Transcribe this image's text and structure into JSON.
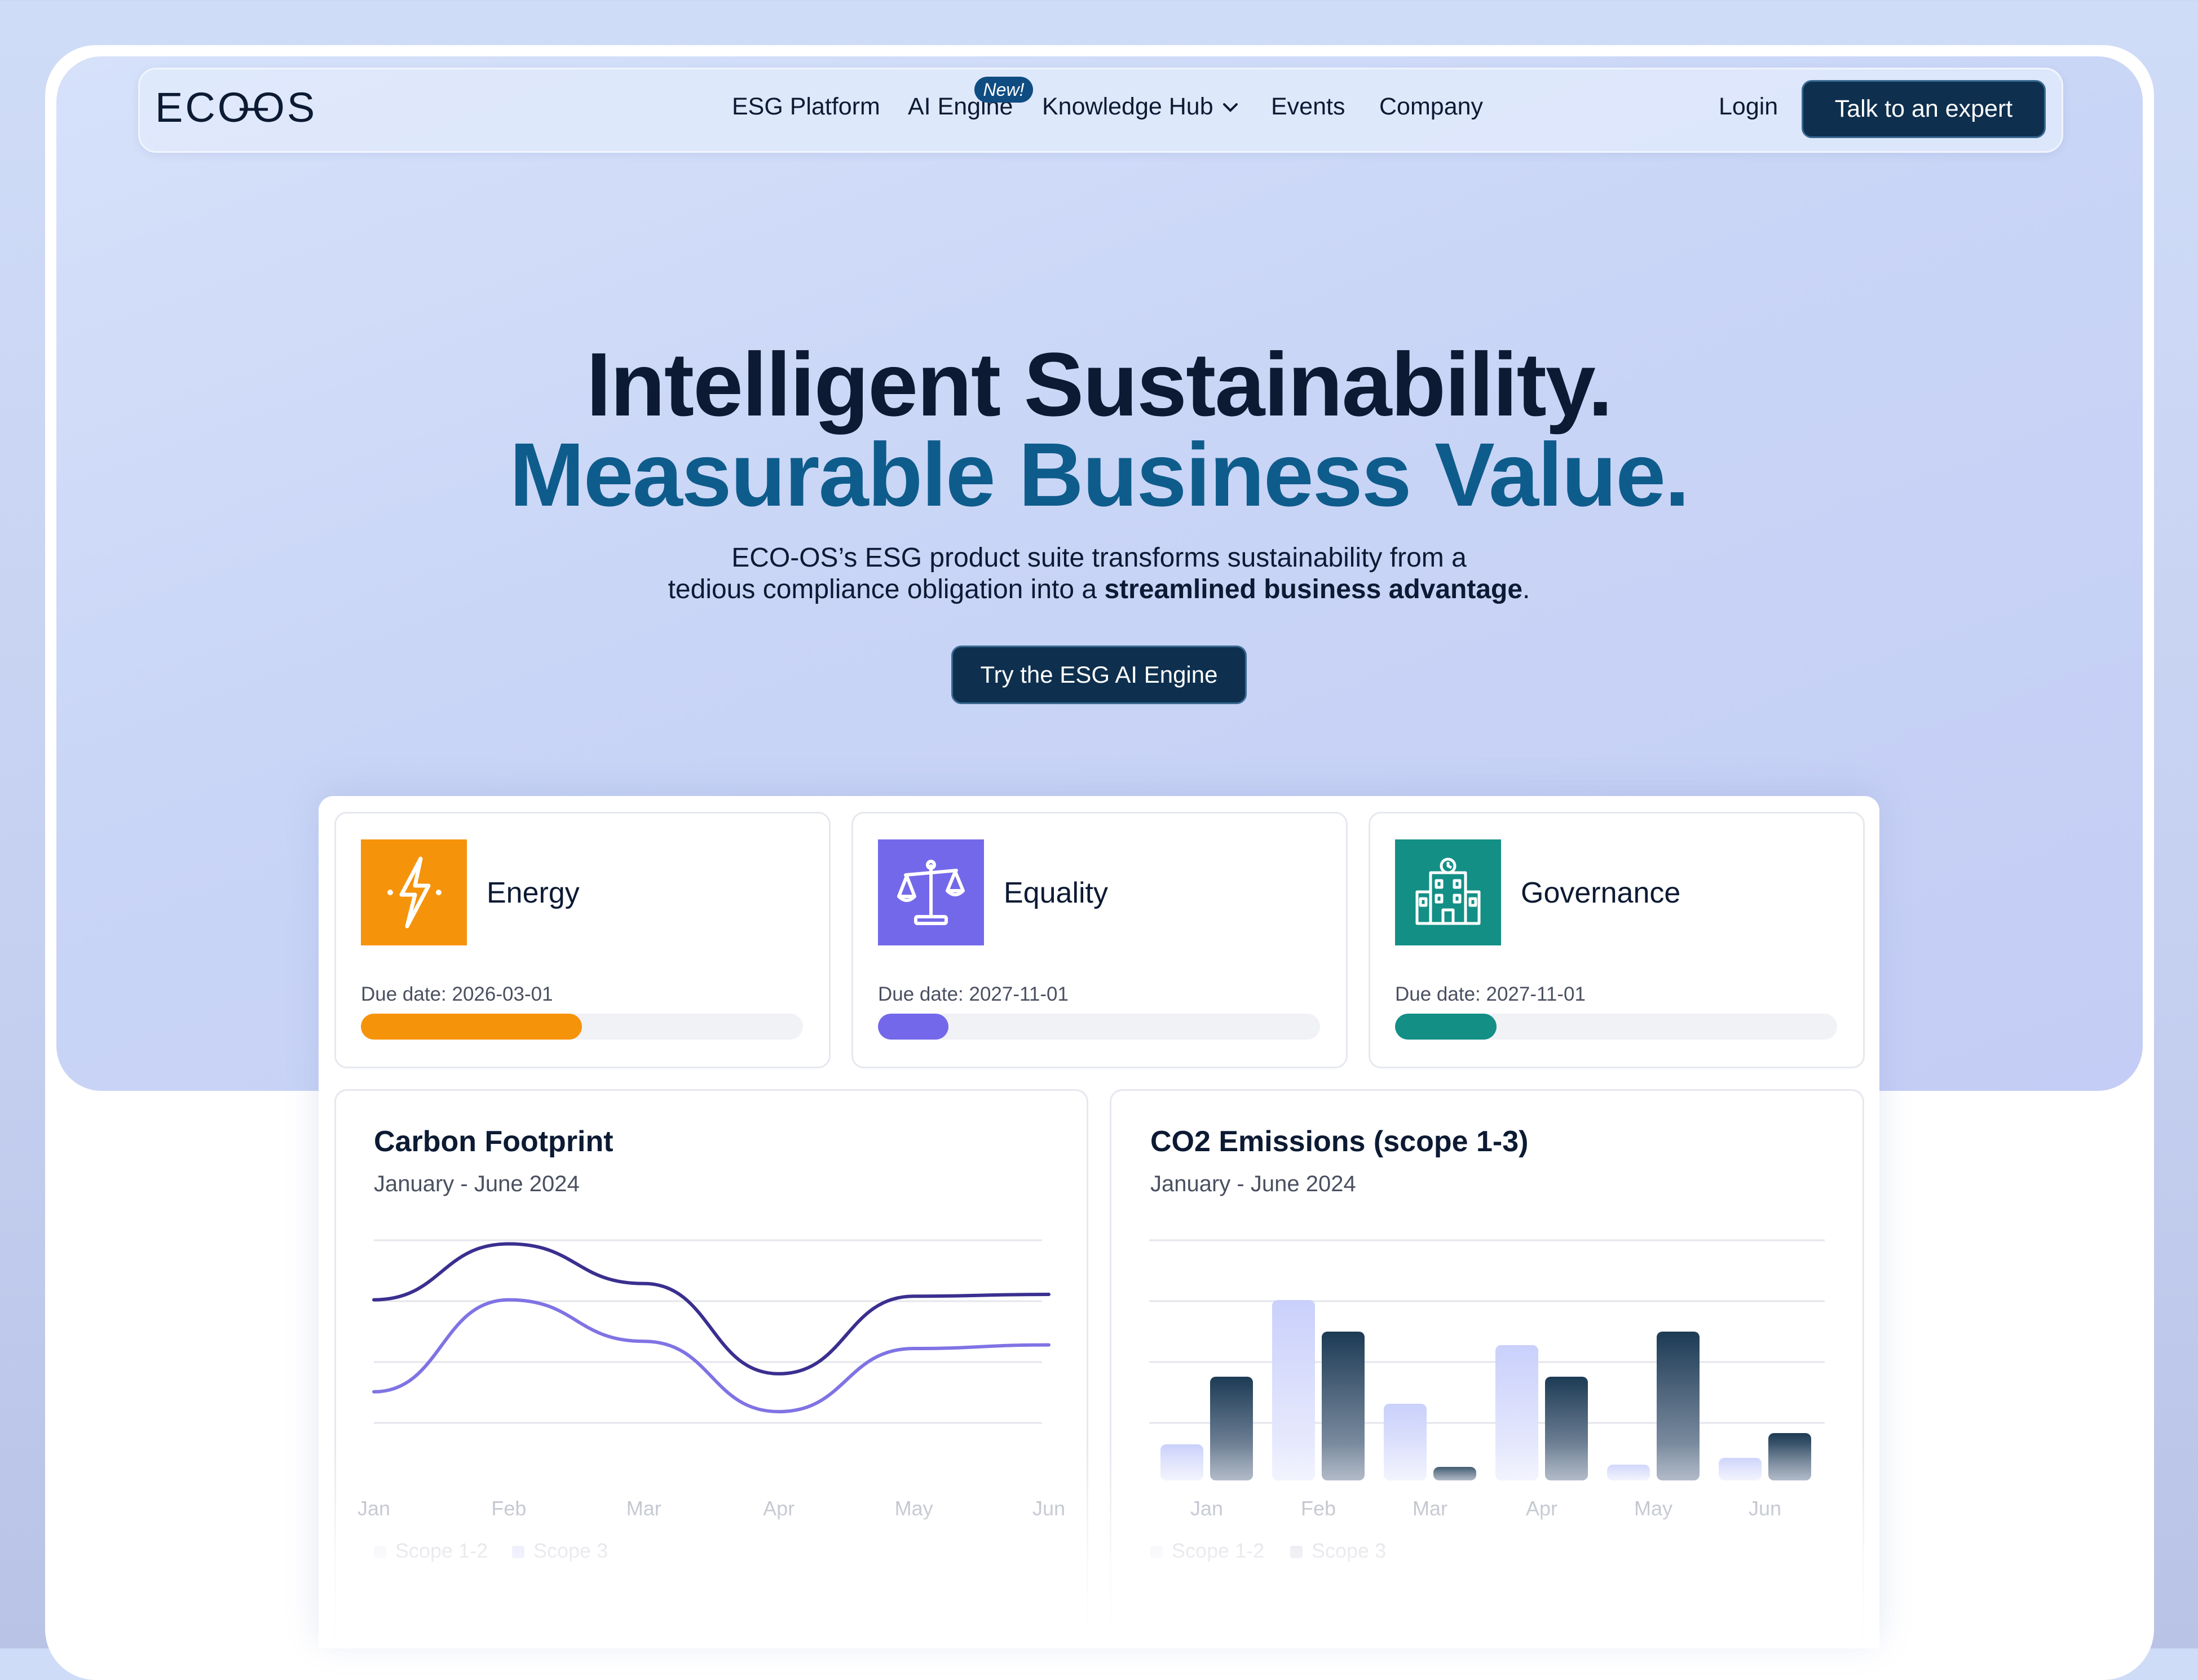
{
  "brand": {
    "logo_text": "ECOOS"
  },
  "nav": {
    "items": [
      {
        "label": "ESG Platform"
      },
      {
        "label": "AI Engine",
        "badge": "New!"
      },
      {
        "label": "Knowledge Hub"
      },
      {
        "label": "Events"
      },
      {
        "label": "Company"
      }
    ],
    "login_label": "Login",
    "cta_label": "Talk to an expert"
  },
  "hero": {
    "headline_1": "Intelligent Sustainability.",
    "headline_2": "Measurable Business Value.",
    "description_line_1": "ECO-OS’s ESG product suite transforms sustainability from a",
    "description_line_2_pre": "tedious compliance obligation into a ",
    "description_line_2_bold": "streamlined business advantage",
    "description_line_2_post": ".",
    "cta_label": "Try the ESG AI Engine"
  },
  "cards": [
    {
      "title": "Energy",
      "due": "Due date: 2026-03-01",
      "progress": 0.5,
      "color": "#f5930a",
      "icon": "lightning-icon"
    },
    {
      "title": "Equality",
      "due": "Due date: 2027-11-01",
      "progress": 0.16,
      "color": "#7468ea",
      "icon": "scales-icon"
    },
    {
      "title": "Governance",
      "due": "Due date: 2027-11-01",
      "progress": 0.23,
      "color": "#138f86",
      "icon": "building-icon"
    }
  ],
  "chart_data": [
    {
      "type": "line",
      "title": "Carbon Footprint",
      "subtitle": "January - June 2024",
      "categories": [
        "Jan",
        "Feb",
        "Mar",
        "Apr",
        "May",
        "Jun"
      ],
      "series": [
        {
          "name": "Scope 1-2",
          "values": [
            67,
            98,
            76,
            26,
            69,
            70
          ],
          "color": "#3a2f8f"
        },
        {
          "name": "Scope 3",
          "values": [
            16,
            67,
            44,
            5,
            40,
            42
          ],
          "color": "#7f73e4"
        }
      ],
      "ylim": [
        -100,
        100
      ],
      "legend": "bottom-left"
    },
    {
      "type": "bar",
      "title": "CO2 Emissions (scope 1-3)",
      "subtitle": "January - June 2024",
      "categories": [
        "Jan",
        "Feb",
        "Mar",
        "Apr",
        "May",
        "Jun"
      ],
      "series": [
        {
          "name": "Scope 1-2",
          "values": [
            16,
            80,
            34,
            60,
            7,
            10
          ]
        },
        {
          "name": "Scope 3",
          "values": [
            46,
            66,
            6,
            46,
            66,
            21
          ]
        }
      ],
      "ylim": [
        0,
        100
      ],
      "legend": "bottom-left"
    }
  ]
}
